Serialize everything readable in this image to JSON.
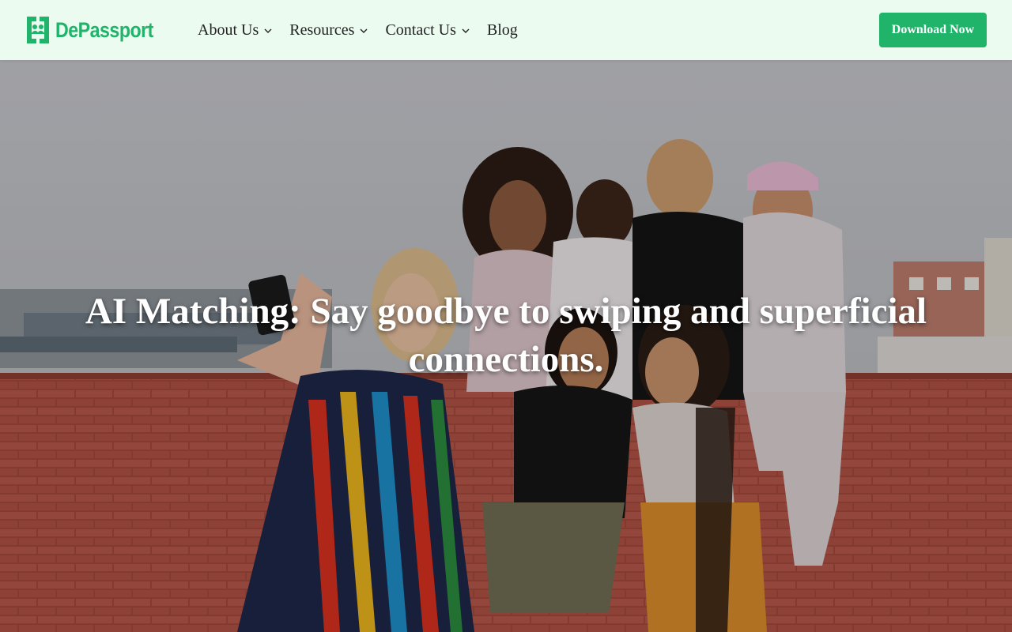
{
  "header": {
    "logo": {
      "text": "DePassport",
      "icon": "passport-people-logo-icon"
    },
    "nav": [
      {
        "label": "About Us",
        "has_dropdown": true
      },
      {
        "label": "Resources",
        "has_dropdown": true
      },
      {
        "label": "Contact Us",
        "has_dropdown": true
      },
      {
        "label": "Blog",
        "has_dropdown": false
      }
    ],
    "cta_label": "Download Now"
  },
  "hero": {
    "title": "AI Matching: Say goodbye to swiping and superficial connections.",
    "image": "group-of-friends-selfie-photo"
  },
  "colors": {
    "brand": "#1fb46a",
    "header_bg": "#ebfbf0",
    "nav_text": "#222222",
    "hero_text": "#ffffff"
  }
}
